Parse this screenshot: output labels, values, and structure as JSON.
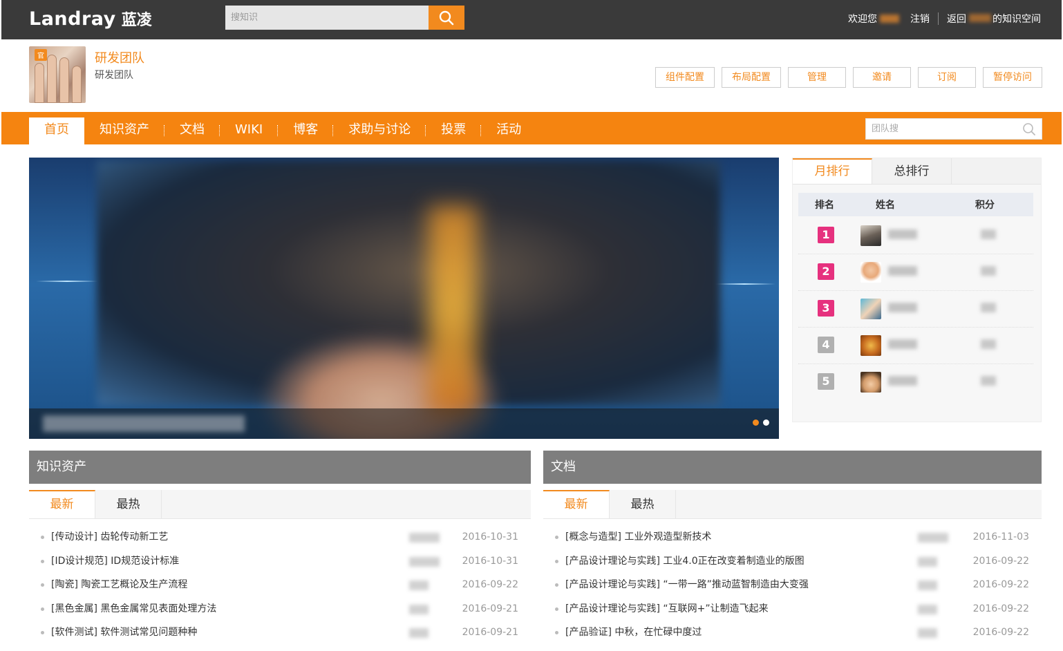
{
  "header": {
    "logo_brand": "Landray",
    "logo_cn": "蓝凌",
    "search_placeholder": "搜知识",
    "welcome": "欢迎您",
    "logout": "注销",
    "back_prefix": "返回",
    "back_suffix": "的知识空间"
  },
  "team": {
    "badge": "官",
    "name": "研发团队",
    "description": "研发团队",
    "actions": [
      "组件配置",
      "布局配置",
      "管理",
      "邀请",
      "订阅",
      "暂停访问"
    ]
  },
  "nav": {
    "items": [
      "首页",
      "知识资产",
      "文档",
      "WIKI",
      "博客",
      "求助与讨论",
      "投票",
      "活动"
    ],
    "active_index": 0,
    "search_placeholder": "团队搜"
  },
  "banner": {
    "slide_count": 2,
    "active_slide": 0
  },
  "ranking": {
    "tabs": [
      "月排行",
      "总排行"
    ],
    "active_tab": 0,
    "columns": [
      "排名",
      "姓名",
      "积分"
    ],
    "rows": [
      {
        "rank": "1",
        "avatar": "portrait-avatar"
      },
      {
        "rank": "2",
        "avatar": "cartoon-boy-avatar"
      },
      {
        "rank": "3",
        "avatar": "cartoon-girl-avatar"
      },
      {
        "rank": "4",
        "avatar": "lion-avatar"
      },
      {
        "rank": "5",
        "avatar": "cartoon-kid-avatar"
      }
    ]
  },
  "knowledge": {
    "title": "知识资产",
    "tabs": [
      "最新",
      "最热"
    ],
    "items": [
      {
        "title": "[传动设计] 齿轮传动新工艺",
        "date": "2016-10-31"
      },
      {
        "title": "[ID设计规范] ID规范设计标准",
        "date": "2016-10-31"
      },
      {
        "title": "[陶瓷] 陶瓷工艺概论及生产流程",
        "date": "2016-09-22"
      },
      {
        "title": "[黑色金属] 黑色金属常见表面处理方法",
        "date": "2016-09-21"
      },
      {
        "title": "[软件测试] 软件测试常见问题种种",
        "date": "2016-09-21"
      }
    ]
  },
  "docs": {
    "title": "文档",
    "tabs": [
      "最新",
      "最热"
    ],
    "items": [
      {
        "title": "[概念与造型] 工业外观造型新技术",
        "date": "2016-11-03"
      },
      {
        "title": "[产品设计理论与实践] 工业4.0正在改变着制造业的版图",
        "date": "2016-09-22"
      },
      {
        "title": "[产品设计理论与实践] “一带一路”推动蓝智制造由大变强",
        "date": "2016-09-22"
      },
      {
        "title": "[产品设计理论与实践] “互联网+”让制造飞起来",
        "date": "2016-09-22"
      },
      {
        "title": "[产品验证] 中秋，在忙碌中度过",
        "date": "2016-09-22"
      }
    ]
  },
  "colors": {
    "accent": "#f28a1e",
    "nav_bg": "#f58410",
    "topbar_bg": "#3a3a3a",
    "rank_hot": "#e6317e",
    "rank_cold": "#b0b0b0"
  }
}
